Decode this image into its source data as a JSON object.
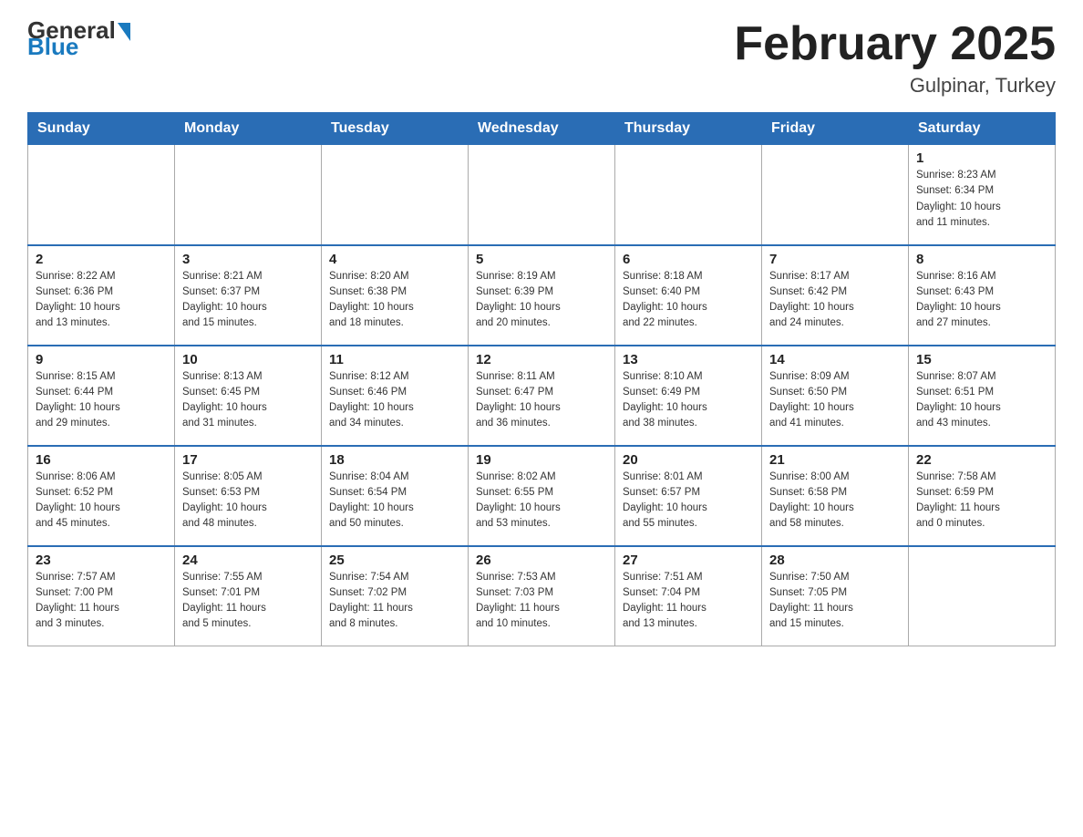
{
  "header": {
    "logo_general": "General",
    "logo_blue": "Blue",
    "month_title": "February 2025",
    "location": "Gulpinar, Turkey"
  },
  "weekdays": [
    "Sunday",
    "Monday",
    "Tuesday",
    "Wednesday",
    "Thursday",
    "Friday",
    "Saturday"
  ],
  "weeks": [
    [
      {
        "day": "",
        "info": ""
      },
      {
        "day": "",
        "info": ""
      },
      {
        "day": "",
        "info": ""
      },
      {
        "day": "",
        "info": ""
      },
      {
        "day": "",
        "info": ""
      },
      {
        "day": "",
        "info": ""
      },
      {
        "day": "1",
        "info": "Sunrise: 8:23 AM\nSunset: 6:34 PM\nDaylight: 10 hours\nand 11 minutes."
      }
    ],
    [
      {
        "day": "2",
        "info": "Sunrise: 8:22 AM\nSunset: 6:36 PM\nDaylight: 10 hours\nand 13 minutes."
      },
      {
        "day": "3",
        "info": "Sunrise: 8:21 AM\nSunset: 6:37 PM\nDaylight: 10 hours\nand 15 minutes."
      },
      {
        "day": "4",
        "info": "Sunrise: 8:20 AM\nSunset: 6:38 PM\nDaylight: 10 hours\nand 18 minutes."
      },
      {
        "day": "5",
        "info": "Sunrise: 8:19 AM\nSunset: 6:39 PM\nDaylight: 10 hours\nand 20 minutes."
      },
      {
        "day": "6",
        "info": "Sunrise: 8:18 AM\nSunset: 6:40 PM\nDaylight: 10 hours\nand 22 minutes."
      },
      {
        "day": "7",
        "info": "Sunrise: 8:17 AM\nSunset: 6:42 PM\nDaylight: 10 hours\nand 24 minutes."
      },
      {
        "day": "8",
        "info": "Sunrise: 8:16 AM\nSunset: 6:43 PM\nDaylight: 10 hours\nand 27 minutes."
      }
    ],
    [
      {
        "day": "9",
        "info": "Sunrise: 8:15 AM\nSunset: 6:44 PM\nDaylight: 10 hours\nand 29 minutes."
      },
      {
        "day": "10",
        "info": "Sunrise: 8:13 AM\nSunset: 6:45 PM\nDaylight: 10 hours\nand 31 minutes."
      },
      {
        "day": "11",
        "info": "Sunrise: 8:12 AM\nSunset: 6:46 PM\nDaylight: 10 hours\nand 34 minutes."
      },
      {
        "day": "12",
        "info": "Sunrise: 8:11 AM\nSunset: 6:47 PM\nDaylight: 10 hours\nand 36 minutes."
      },
      {
        "day": "13",
        "info": "Sunrise: 8:10 AM\nSunset: 6:49 PM\nDaylight: 10 hours\nand 38 minutes."
      },
      {
        "day": "14",
        "info": "Sunrise: 8:09 AM\nSunset: 6:50 PM\nDaylight: 10 hours\nand 41 minutes."
      },
      {
        "day": "15",
        "info": "Sunrise: 8:07 AM\nSunset: 6:51 PM\nDaylight: 10 hours\nand 43 minutes."
      }
    ],
    [
      {
        "day": "16",
        "info": "Sunrise: 8:06 AM\nSunset: 6:52 PM\nDaylight: 10 hours\nand 45 minutes."
      },
      {
        "day": "17",
        "info": "Sunrise: 8:05 AM\nSunset: 6:53 PM\nDaylight: 10 hours\nand 48 minutes."
      },
      {
        "day": "18",
        "info": "Sunrise: 8:04 AM\nSunset: 6:54 PM\nDaylight: 10 hours\nand 50 minutes."
      },
      {
        "day": "19",
        "info": "Sunrise: 8:02 AM\nSunset: 6:55 PM\nDaylight: 10 hours\nand 53 minutes."
      },
      {
        "day": "20",
        "info": "Sunrise: 8:01 AM\nSunset: 6:57 PM\nDaylight: 10 hours\nand 55 minutes."
      },
      {
        "day": "21",
        "info": "Sunrise: 8:00 AM\nSunset: 6:58 PM\nDaylight: 10 hours\nand 58 minutes."
      },
      {
        "day": "22",
        "info": "Sunrise: 7:58 AM\nSunset: 6:59 PM\nDaylight: 11 hours\nand 0 minutes."
      }
    ],
    [
      {
        "day": "23",
        "info": "Sunrise: 7:57 AM\nSunset: 7:00 PM\nDaylight: 11 hours\nand 3 minutes."
      },
      {
        "day": "24",
        "info": "Sunrise: 7:55 AM\nSunset: 7:01 PM\nDaylight: 11 hours\nand 5 minutes."
      },
      {
        "day": "25",
        "info": "Sunrise: 7:54 AM\nSunset: 7:02 PM\nDaylight: 11 hours\nand 8 minutes."
      },
      {
        "day": "26",
        "info": "Sunrise: 7:53 AM\nSunset: 7:03 PM\nDaylight: 11 hours\nand 10 minutes."
      },
      {
        "day": "27",
        "info": "Sunrise: 7:51 AM\nSunset: 7:04 PM\nDaylight: 11 hours\nand 13 minutes."
      },
      {
        "day": "28",
        "info": "Sunrise: 7:50 AM\nSunset: 7:05 PM\nDaylight: 11 hours\nand 15 minutes."
      },
      {
        "day": "",
        "info": ""
      }
    ]
  ]
}
